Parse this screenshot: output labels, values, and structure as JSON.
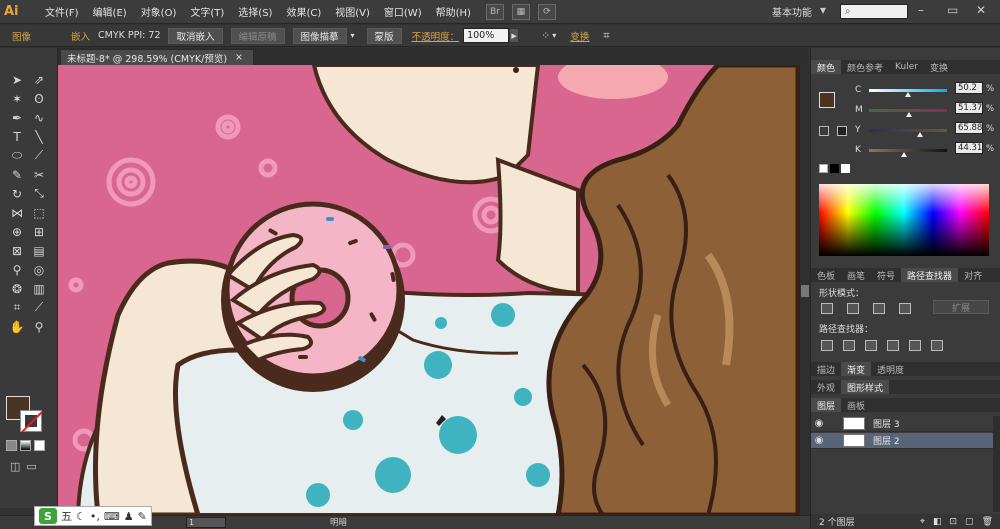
{
  "app": {
    "logo": "Ai",
    "workspace": "基本功能",
    "search_icon": "search-icon"
  },
  "menu": [
    "文件(F)",
    "编辑(E)",
    "对象(O)",
    "文字(T)",
    "选择(S)",
    "效果(C)",
    "视图(V)",
    "窗口(W)",
    "帮助(H)"
  ],
  "control_bar": {
    "object_type": "图像",
    "embed": "嵌入",
    "color_info": "CMYK  PPI: 72",
    "unembed_btn": "取消嵌入",
    "edit_original_btn": "编辑原稿",
    "trace_btn": "图像描摹",
    "mask_btn": "蒙版",
    "opacity_label": "不透明度：",
    "opacity_value": "100%",
    "transform_link": "变换"
  },
  "document": {
    "tab_title": "未标题-8* @ 298.59% (CMYK/预览)",
    "close": "×"
  },
  "color_panel": {
    "tabs": [
      "颜色",
      "颜色参考",
      "Kuler",
      "变换"
    ],
    "channels": [
      {
        "label": "C",
        "value": "50.2",
        "unit": "%",
        "fraction": 0.502
      },
      {
        "label": "M",
        "value": "51.37",
        "unit": "%",
        "fraction": 0.5137
      },
      {
        "label": "Y",
        "value": "65.88",
        "unit": "%",
        "fraction": 0.6588
      },
      {
        "label": "K",
        "value": "44.31",
        "unit": "%",
        "fraction": 0.4431
      }
    ],
    "fill_color": "#4a3424"
  },
  "pathfinder_panel": {
    "tabs": [
      "色板",
      "画笔",
      "符号",
      "路径查找器",
      "对齐"
    ],
    "shape_modes_label": "形状模式：",
    "expand_btn": "扩展",
    "pathfinders_label": "路径查找器："
  },
  "stroke_tabs": [
    "描边",
    "渐变",
    "透明度"
  ],
  "appearance_tabs": [
    "外观",
    "图形样式"
  ],
  "layers_panel": {
    "tabs": [
      "图层",
      "画板"
    ],
    "layers": [
      {
        "name": "图层 3",
        "selected": false
      },
      {
        "name": "图层 2",
        "selected": true
      }
    ],
    "count": "2 个图层"
  },
  "status": {
    "page": "1",
    "label": "明暗"
  },
  "ime": {
    "logo": "S",
    "text": "五"
  }
}
